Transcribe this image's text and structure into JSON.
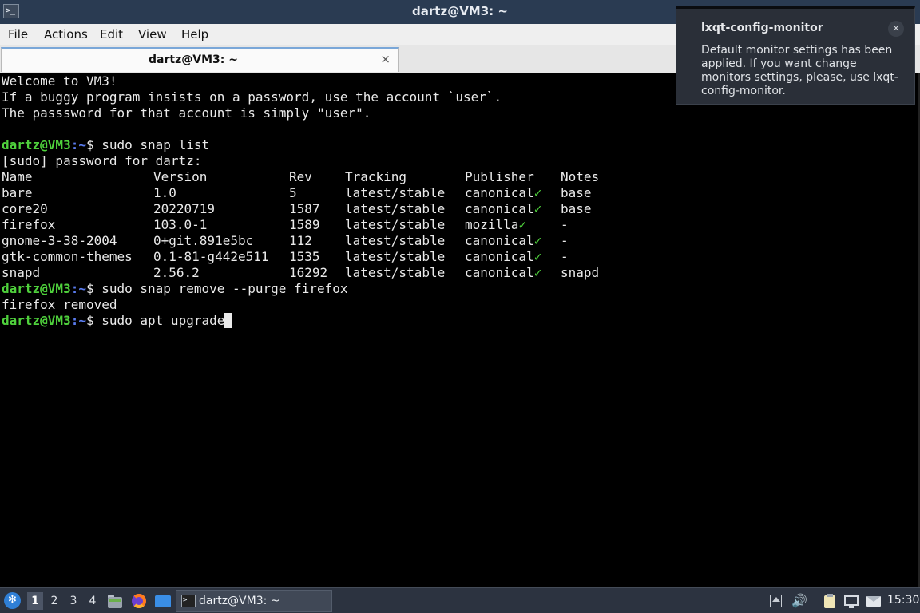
{
  "window": {
    "title": "dartz@VM3: ~",
    "icon": "terminal-icon"
  },
  "menu": {
    "file": "File",
    "actions": "Actions",
    "edit": "Edit",
    "view": "View",
    "help": "Help"
  },
  "tab": {
    "label": "dartz@VM3: ~",
    "close": "×"
  },
  "terminal": {
    "motd": [
      "Welcome to VM3!",
      "If a buggy program insists on a password, use the account `user`.",
      "The passsword for that account is simply \"user\"."
    ],
    "prompt_user": "dartz@VM3",
    "prompt_path": ":~",
    "prompt_suffix": "$ ",
    "cmd1": "sudo snap list",
    "sudo_prompt": "[sudo] password for dartz:",
    "snap_table": {
      "headers": [
        "Name",
        "Version",
        "Rev",
        "Tracking",
        "Publisher",
        "Notes"
      ],
      "rows": [
        {
          "name": "bare",
          "version": "1.0",
          "rev": "5",
          "tracking": "latest/stable",
          "publisher": "canonical",
          "verified": "✓",
          "notes": "base"
        },
        {
          "name": "core20",
          "version": "20220719",
          "rev": "1587",
          "tracking": "latest/stable",
          "publisher": "canonical",
          "verified": "✓",
          "notes": "base"
        },
        {
          "name": "firefox",
          "version": "103.0-1",
          "rev": "1589",
          "tracking": "latest/stable",
          "publisher": "mozilla",
          "verified": "✓",
          "notes": "-"
        },
        {
          "name": "gnome-3-38-2004",
          "version": "0+git.891e5bc",
          "rev": "112",
          "tracking": "latest/stable",
          "publisher": "canonical",
          "verified": "✓",
          "notes": "-"
        },
        {
          "name": "gtk-common-themes",
          "version": "0.1-81-g442e511",
          "rev": "1535",
          "tracking": "latest/stable",
          "publisher": "canonical",
          "verified": "✓",
          "notes": "-"
        },
        {
          "name": "snapd",
          "version": "2.56.2",
          "rev": "16292",
          "tracking": "latest/stable",
          "publisher": "canonical",
          "verified": "✓",
          "notes": "snapd"
        }
      ]
    },
    "cmd2": "sudo snap remove --purge firefox",
    "output2": "firefox removed",
    "cmd3": "sudo apt upgrade"
  },
  "notification": {
    "title": "lxqt-config-monitor",
    "body": "Default monitor settings has been applied. If you want change monitors settings, please, use lxqt-config-monitor.",
    "close": "×"
  },
  "taskbar": {
    "start_icon": "lxqt-start-icon",
    "workspaces": [
      "1",
      "2",
      "3",
      "4"
    ],
    "active_workspace": "1",
    "quicklaunch": [
      "file-manager-icon",
      "firefox-icon",
      "show-desktop-icon"
    ],
    "task_label": "dartz@VM3: ~",
    "tray": [
      "tray-arrow-icon",
      "volume-icon",
      "clipboard-icon",
      "network-icon",
      "notification-icon"
    ],
    "volume_glyph": "🔊",
    "clock": "15:30"
  }
}
